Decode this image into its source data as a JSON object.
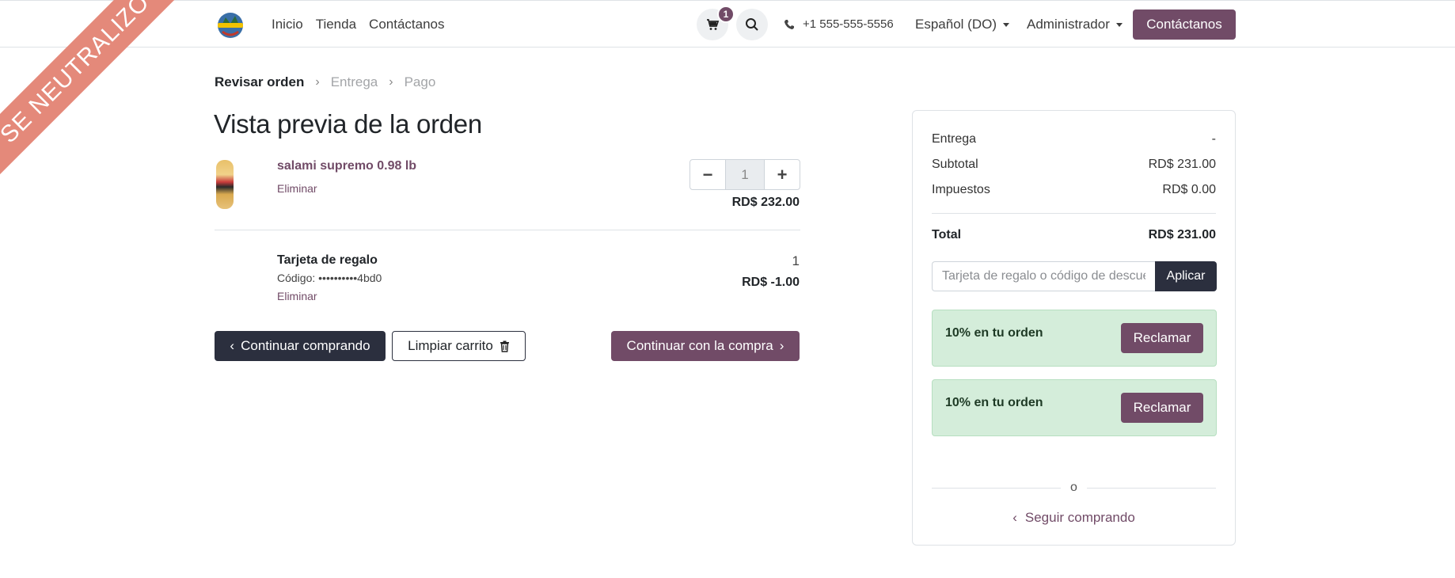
{
  "ribbon": {
    "text": "SE NEUTRALIZÓ"
  },
  "header": {
    "nav": [
      "Inicio",
      "Tienda",
      "Contáctanos"
    ],
    "cart_count": "1",
    "phone": "+1 555-555-5556",
    "language": "Español (DO)",
    "user": "Administrador",
    "contact_button": "Contáctanos"
  },
  "breadcrumb": {
    "step1": "Revisar orden",
    "step2": "Entrega",
    "step3": "Pago"
  },
  "page_title": "Vista previa de la orden",
  "items": [
    {
      "name": "salami supremo 0.98 lb",
      "remove": "Eliminar",
      "quantity": "1",
      "price": "RD$ 232.00"
    },
    {
      "name": "Tarjeta de regalo",
      "code": "Código: ••••••••••4bd0",
      "remove": "Eliminar",
      "quantity": "1",
      "price": "RD$ -1.00"
    }
  ],
  "buttons": {
    "continue_shopping": "Continuar comprando",
    "clear_cart": "Limpiar carrito",
    "checkout": "Continuar con la compra"
  },
  "summary": {
    "delivery_label": "Entrega",
    "delivery_value": "-",
    "subtotal_label": "Subtotal",
    "subtotal_value": "RD$ 231.00",
    "taxes_label": "Impuestos",
    "taxes_value": "RD$ 0.00",
    "total_label": "Total",
    "total_value": "RD$ 231.00",
    "promo_placeholder": "Tarjeta de regalo o código de descuento",
    "apply_label": "Aplicar",
    "offers": [
      {
        "text": "10% en tu orden",
        "button": "Reclamar"
      },
      {
        "text": "10% en tu orden",
        "button": "Reclamar"
      }
    ],
    "or_text": "o",
    "keep_shopping": "Seguir comprando"
  },
  "colors": {
    "brand": "#714b67",
    "dark": "#2b2f3e",
    "offer_bg": "#d4edda",
    "ribbon": "#e4897a"
  }
}
